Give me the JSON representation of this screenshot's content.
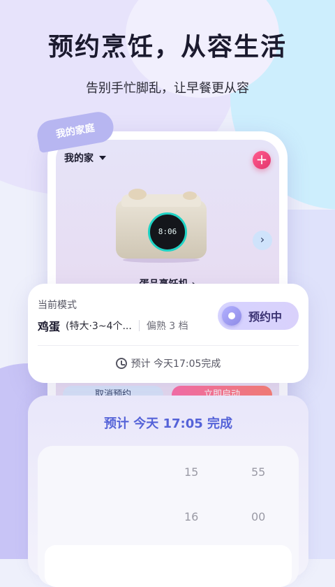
{
  "headline": "预约烹饪，从容生活",
  "subheadline": "告别手忙脚乱，让早餐更从容",
  "family_tag": "我的家庭",
  "home": {
    "label": "我的家"
  },
  "add_label": "+",
  "next_label": "›",
  "device": {
    "name": "蛋品烹饪机 ›",
    "display_time": "8:06"
  },
  "actions": {
    "cancel_label": "取消预约",
    "start_label": "立即启动"
  },
  "mode_card": {
    "label": "当前模式",
    "recipe_name": "鸡蛋",
    "recipe_detail": "(特大·3~4个...",
    "preference": "偏熟 3 档",
    "status": "预约中",
    "eta": "预计  今天17:05完成"
  },
  "sheet": {
    "title": "预计 今天 17:05 完成",
    "hours": [
      "15",
      "16"
    ],
    "minutes": [
      "55",
      "00"
    ]
  }
}
